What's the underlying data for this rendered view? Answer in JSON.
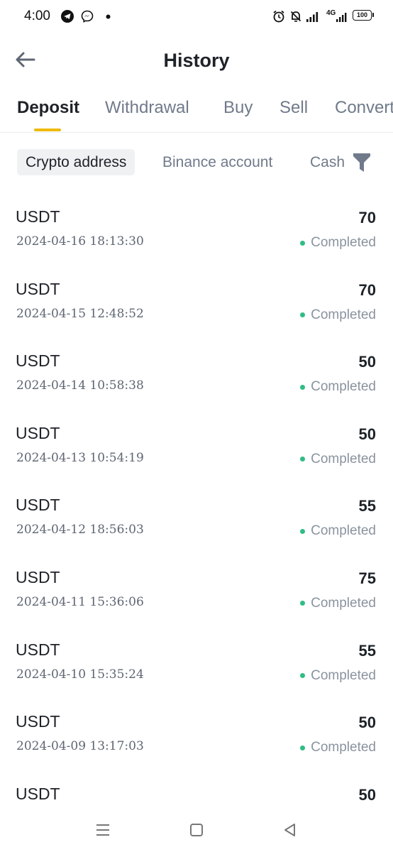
{
  "status_bar": {
    "time": "4:00",
    "network_label": "4G",
    "battery": "100",
    "icons": [
      "telegram-icon",
      "messenger-icon",
      "notification-dot-icon",
      "alarm-icon",
      "mute-icon",
      "signal-icon",
      "signal-icon",
      "battery-icon"
    ]
  },
  "header": {
    "title": "History",
    "back_icon": "arrow-left-icon"
  },
  "tabs": [
    {
      "label": "Deposit",
      "active": true
    },
    {
      "label": "Withdrawal",
      "active": false
    },
    {
      "label": "Buy",
      "active": false
    },
    {
      "label": "Sell",
      "active": false
    },
    {
      "label": "Convert",
      "active": false
    }
  ],
  "filters": {
    "chips": [
      {
        "label": "Crypto address",
        "active": true
      },
      {
        "label": "Binance account",
        "active": false
      },
      {
        "label": "Cash",
        "active": false
      }
    ],
    "filter_icon": "filter-funnel-icon"
  },
  "colors": {
    "accent": "#f0b90b",
    "status_completed": "#2ebd85",
    "text_primary": "#1e2329",
    "text_secondary": "#707a8a"
  },
  "transactions": [
    {
      "coin": "USDT",
      "datetime": "2024-04-16 18:13:30",
      "amount": "70",
      "status": "Completed"
    },
    {
      "coin": "USDT",
      "datetime": "2024-04-15 12:48:52",
      "amount": "70",
      "status": "Completed"
    },
    {
      "coin": "USDT",
      "datetime": "2024-04-14 10:58:38",
      "amount": "50",
      "status": "Completed"
    },
    {
      "coin": "USDT",
      "datetime": "2024-04-13 10:54:19",
      "amount": "50",
      "status": "Completed"
    },
    {
      "coin": "USDT",
      "datetime": "2024-04-12 18:56:03",
      "amount": "55",
      "status": "Completed"
    },
    {
      "coin": "USDT",
      "datetime": "2024-04-11 15:36:06",
      "amount": "75",
      "status": "Completed"
    },
    {
      "coin": "USDT",
      "datetime": "2024-04-10 15:35:24",
      "amount": "55",
      "status": "Completed"
    },
    {
      "coin": "USDT",
      "datetime": "2024-04-09 13:17:03",
      "amount": "50",
      "status": "Completed"
    },
    {
      "coin": "USDT",
      "datetime": "",
      "amount": "50",
      "status": ""
    }
  ],
  "navbar": {
    "icons": [
      "menu-icon",
      "home-square-icon",
      "back-triangle-icon"
    ]
  }
}
